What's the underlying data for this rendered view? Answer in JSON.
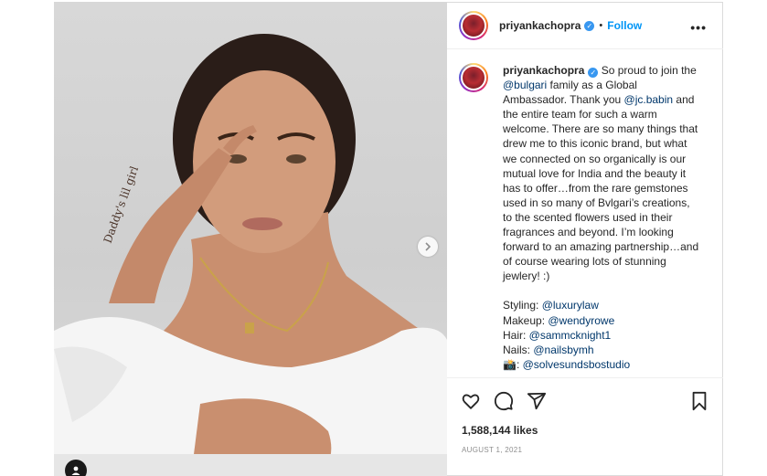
{
  "post": {
    "username": "priyankachopra",
    "follow_label": "Follow",
    "separator": "•",
    "more_label": "•••",
    "verified_mark": "✓"
  },
  "caption": {
    "username": "priyankachopra",
    "t1": " So proud to join the ",
    "m1": "@bulgari",
    "t2": " family as a Global Ambassador. Thank you ",
    "m2": "@jc.babin",
    "t3": " and the entire team for such a warm welcome. There are so many things that drew me to this iconic brand, but what we connected on so organically is our mutual love for India and the beauty it has to offer…from the rare gemstones used in so many of Bvlgari’s creations, to the scented flowers used in their fragrances and beyond. I’m looking forward to an amazing partnership…and of course wearing lots of stunning jewlery! :)",
    "credits": [
      {
        "label": "Styling: ",
        "handle": "@luxurylaw"
      },
      {
        "label": "Makeup: ",
        "handle": "@wendyrowe"
      },
      {
        "label": "Hair: ",
        "handle": "@sammcknight1"
      },
      {
        "label": "Nails: ",
        "handle": "@nailsbymh"
      },
      {
        "label": "📸: ",
        "handle": "@solvesundsbostudio"
      }
    ]
  },
  "stats": {
    "likes": "1,588,144 likes",
    "date": "AUGUST 1, 2021"
  },
  "icons": {
    "like": "heart-icon",
    "comment": "comment-icon",
    "share": "share-icon",
    "save": "bookmark-icon",
    "next": "chevron-right-icon",
    "tags": "user-tag-icon"
  },
  "colors": {
    "link": "#00376b",
    "follow": "#0095f6",
    "verified": "#3897f0"
  }
}
